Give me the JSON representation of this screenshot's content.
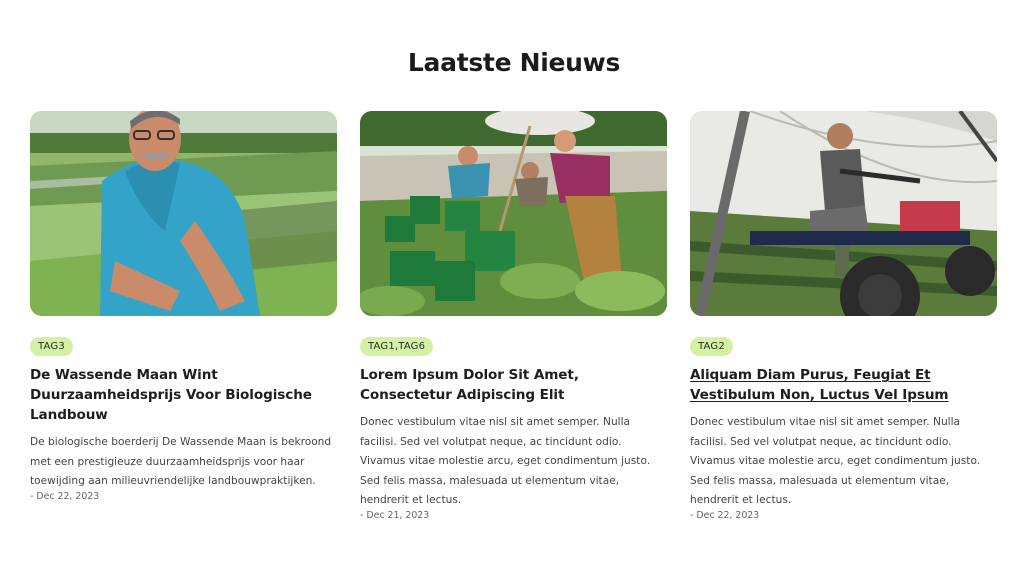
{
  "section": {
    "title": "Laatste Nieuws"
  },
  "articles": [
    {
      "tags": "TAG3",
      "title": "De Wassende Maan Wint Duurzaamheidsprijs Voor Biologische Landbouw",
      "excerpt": "De biologische boerderij De Wassende Maan is bekroond met een prestigieuze duurzaamheidsprijs voor haar toewijding aan milieuvriendelijke landbouwpraktijken.",
      "date": "- Dec 22, 2023"
    },
    {
      "tags": "TAG1,TAG6",
      "title": "Lorem Ipsum Dolor Sit Amet, Consectetur Adipiscing Elit",
      "excerpt": "Donec vestibulum vitae nisl sit amet semper. Nulla facilisi. Sed vel volutpat neque, ac tincidunt odio. Vivamus vitae molestie arcu, eget condimentum justo. Sed felis massa, malesuada ut elementum vitae, hendrerit et lectus.",
      "date": "- Dec 21, 2023"
    },
    {
      "tags": "TAG2",
      "title": "Aliquam Diam Purus, Feugiat Et Vestibulum Non, Luctus Vel Ipsum",
      "excerpt": "Donec vestibulum vitae nisl sit amet semper. Nulla facilisi. Sed vel volutpat neque, ac tincidunt odio. Vivamus vitae molestie arcu, eget condimentum justo. Sed felis massa, malesuada ut elementum vitae, hendrerit et lectus.",
      "date": "- Dec 22, 2023"
    }
  ],
  "colors": {
    "tag_bg": "#d4f0a3",
    "title": "#1b1b1b",
    "text": "#444444"
  }
}
